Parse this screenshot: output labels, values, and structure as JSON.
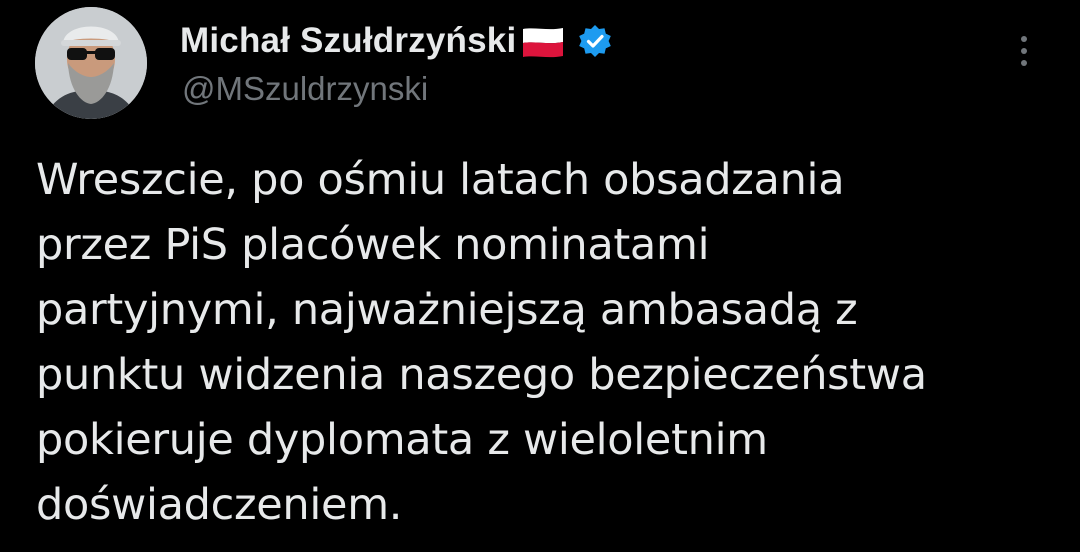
{
  "author": {
    "display_name": "Michał Szułdrzyński",
    "flag_icon": "poland-flag-icon",
    "verified_icon": "verified-badge-icon",
    "handle": "@MSzuldrzynski",
    "avatar": "avatar-photo"
  },
  "menu": {
    "icon": "more-vertical-icon"
  },
  "tweet": {
    "text": "Wreszcie, po ośmiu latach obsadzania\nprzez PiS placówek nominatami\npartyjnymi, najważniejszą ambasadą z\npunktu widzenia naszego bezpieczeństwa\npokieruje dyplomata z wieloletnim\ndoświadczeniem."
  },
  "colors": {
    "background": "#000000",
    "text": "#e7e9ea",
    "secondary_text": "#71767b",
    "verified_blue": "#1d9bf0",
    "flag_white": "#ffffff",
    "flag_red": "#dc143c"
  }
}
